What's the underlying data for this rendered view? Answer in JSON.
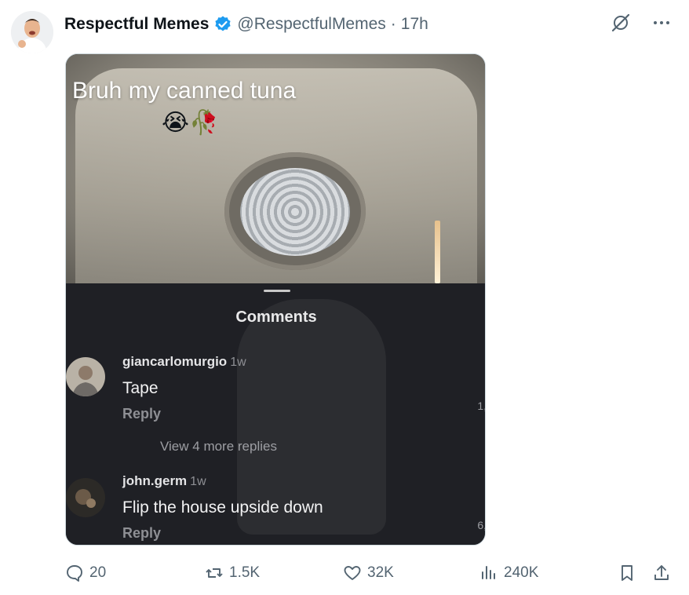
{
  "author": {
    "name": "Respectful Memes",
    "handle": "@RespectfulMemes",
    "separator": "·",
    "time": "17h"
  },
  "media": {
    "caption": "Bruh my canned tuna",
    "caption_emoji": "😭🥀",
    "sheet_title": "Comments",
    "comments": [
      {
        "user": "giancarlomurgio",
        "age": "1w",
        "text": "Tape",
        "reply": "Reply",
        "side": "1,",
        "more": "View 4 more replies"
      },
      {
        "user": "john.germ",
        "age": "1w",
        "text": "Flip the house upside down",
        "reply": "Reply",
        "side": "6,"
      }
    ]
  },
  "actions": {
    "replies": "20",
    "reposts": "1.5K",
    "likes": "32K",
    "views": "240K"
  },
  "colors": {
    "verified": "#1d9bf0",
    "muted": "#536471"
  }
}
